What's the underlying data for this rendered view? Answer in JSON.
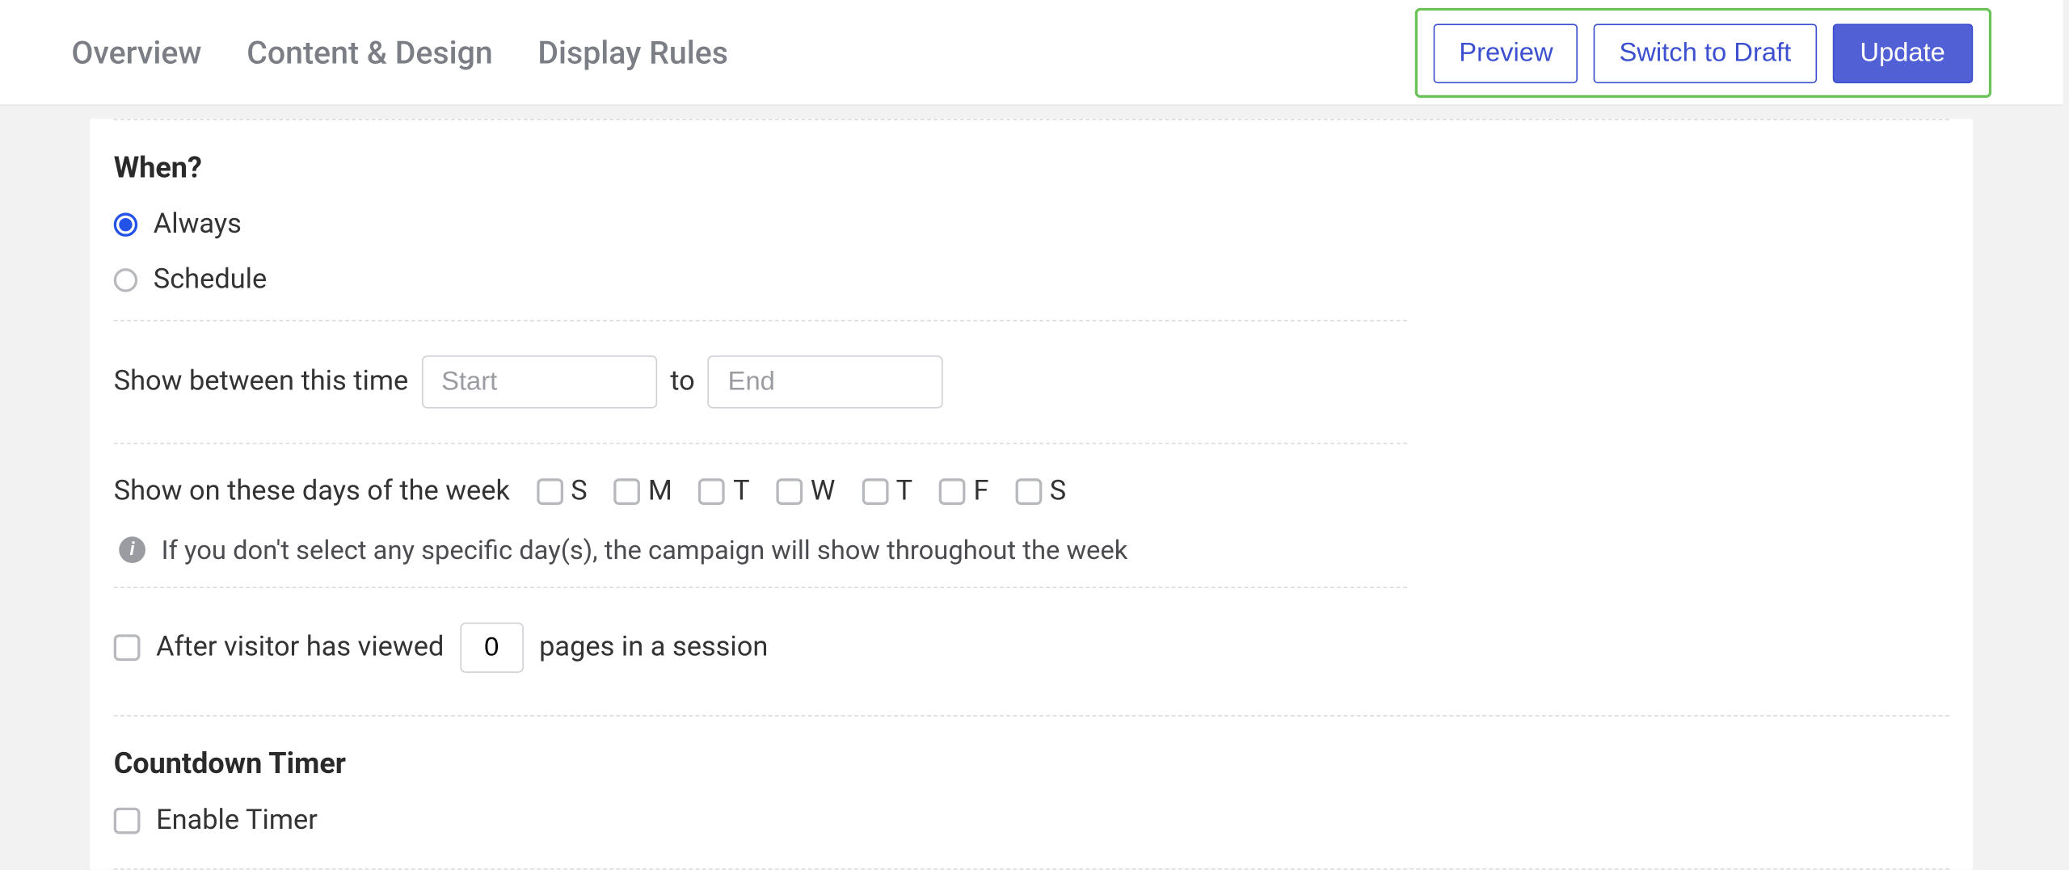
{
  "tabs": {
    "overview": "Overview",
    "content": "Content & Design",
    "display": "Display Rules"
  },
  "actions": {
    "preview": "Preview",
    "draft": "Switch to Draft",
    "update": "Update"
  },
  "when": {
    "title": "When?",
    "always": "Always",
    "schedule": "Schedule",
    "show_between": "Show between this time",
    "start_placeholder": "Start",
    "to": "to",
    "end_placeholder": "End",
    "days_label": "Show on these days of the week",
    "days": [
      "S",
      "M",
      "T",
      "W",
      "T",
      "F",
      "S"
    ],
    "hint": "If you don't select any specific day(s), the campaign will show throughout the week",
    "after_viewed": "After visitor has viewed",
    "pages_value": "0",
    "pages_suffix": "pages in a session"
  },
  "countdown": {
    "title": "Countdown Timer",
    "enable": "Enable Timer"
  }
}
